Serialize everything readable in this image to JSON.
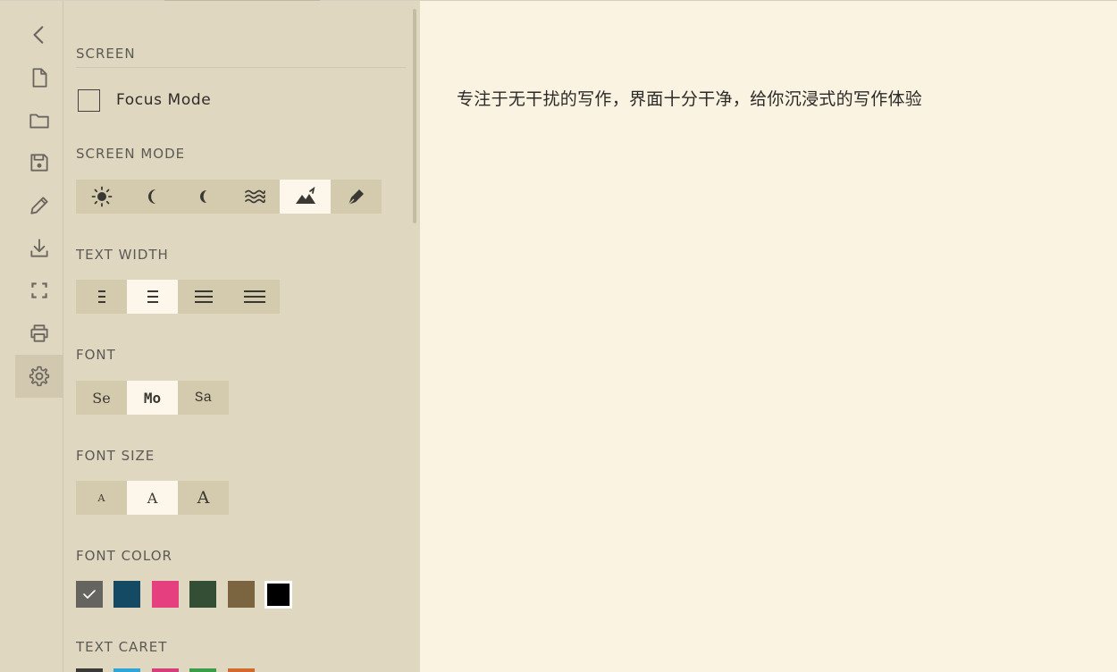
{
  "rail": {
    "items": [
      {
        "icon": "chevron-left-icon"
      },
      {
        "icon": "file-icon"
      },
      {
        "icon": "folder-icon"
      },
      {
        "icon": "save-icon"
      },
      {
        "icon": "pencil-icon"
      },
      {
        "icon": "download-icon"
      },
      {
        "icon": "fullscreen-icon"
      },
      {
        "icon": "print-icon"
      },
      {
        "icon": "gear-icon",
        "active": true
      }
    ]
  },
  "settings": {
    "screen": {
      "title": "SCREEN",
      "focus_mode_label": "Focus Mode",
      "focus_mode_checked": false
    },
    "screen_mode": {
      "title": "SCREEN MODE",
      "options": [
        "sun-icon",
        "moon-icon",
        "moon-thin-icon",
        "waves-icon",
        "mountain-icon",
        "pen-nib-icon"
      ],
      "selected": "mountain-icon"
    },
    "text_width": {
      "title": "TEXT WIDTH",
      "options": [
        "narrow-width-icon",
        "medium-width-icon",
        "wide-width-icon",
        "full-width-icon"
      ],
      "selected": "medium-width-icon"
    },
    "font": {
      "title": "FONT",
      "options": [
        "Se",
        "Mo",
        "Sa"
      ],
      "selected": "Mo"
    },
    "font_size": {
      "title": "FONT SIZE",
      "options": [
        "A",
        "A",
        "A"
      ],
      "selected_index": 1
    },
    "font_color": {
      "title": "FONT COLOR",
      "colors": [
        "#66645f",
        "#144a63",
        "#e63f7f",
        "#344d35",
        "#7b6440",
        "#000000"
      ],
      "selected": "#66645f"
    },
    "text_caret": {
      "title": "TEXT CARET",
      "colors": [
        "#3c3a36",
        "#2fa6d9",
        "#d6407a",
        "#3b9c4a",
        "#d36a2d"
      ]
    }
  },
  "editor": {
    "content": "专注于无干扰的写作，界面十分干净，给你沉浸式的写作体验"
  }
}
